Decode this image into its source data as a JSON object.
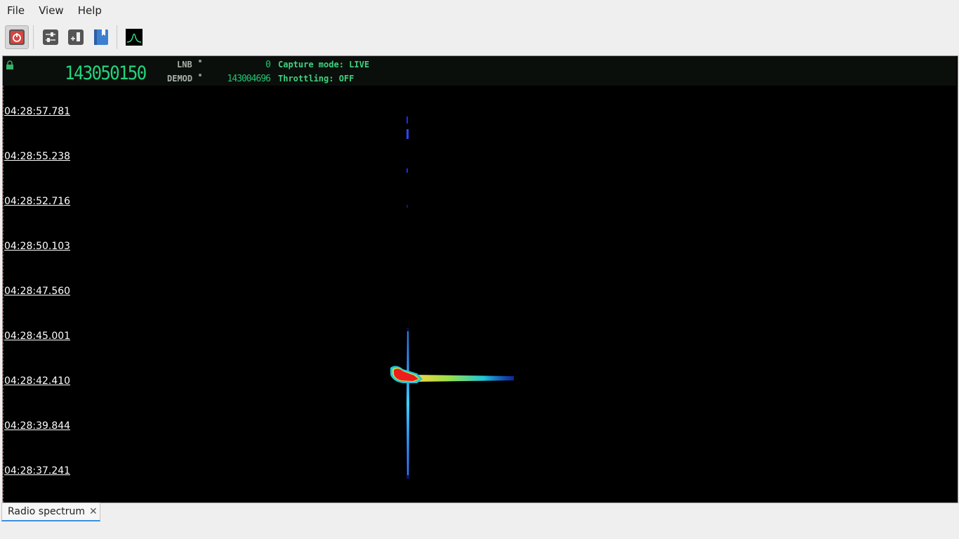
{
  "menubar": {
    "items": [
      "File",
      "View",
      "Help"
    ]
  },
  "toolbar": {
    "buttons": [
      {
        "name": "power-button",
        "icon": "power-icon",
        "pressed": true
      },
      {
        "name": "settings-button",
        "icon": "sliders-icon"
      },
      {
        "name": "add-panel-button",
        "icon": "add-panel-icon"
      },
      {
        "name": "bookmark-button",
        "icon": "bookmark-icon"
      },
      {
        "name": "spectrum-button",
        "icon": "spectrum-icon"
      }
    ]
  },
  "header": {
    "main_frequency": "143050150",
    "lnb_label": "LNB",
    "lnb_value": "0",
    "demod_label": "DEMOD",
    "demod_value": "143004696",
    "capture_mode": "Capture mode: LIVE",
    "throttling": "Throttling: OFF"
  },
  "waterfall": {
    "timestamps": [
      "04:28:57.781",
      "04:28:55.238",
      "04:28:52.716",
      "04:28:50.103",
      "04:28:47.560",
      "04:28:45.001",
      "04:28:42.410",
      "04:28:39.844",
      "04:28:37.241"
    ]
  },
  "tabs": [
    {
      "label": "Radio spectrum",
      "close_icon": "close-icon"
    }
  ],
  "colors": {
    "freq_green": "#22d37a",
    "tab_accent": "#3b8ee0",
    "power_red": "#d64541"
  }
}
